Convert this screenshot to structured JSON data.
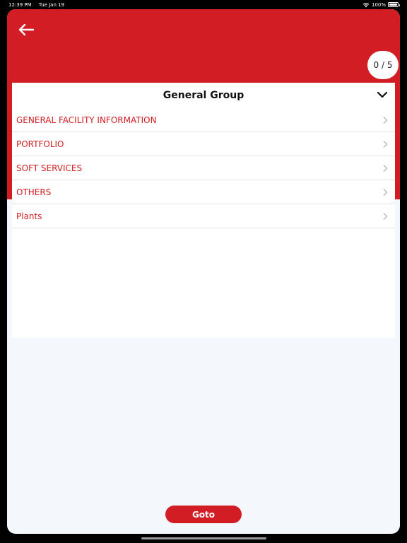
{
  "status_bar": {
    "time": "12:39 PM",
    "date": "Tue Jan 19",
    "battery": "100%",
    "wifi_icon": "wifi-icon",
    "battery_icon": "battery-icon"
  },
  "header": {
    "back_icon": "arrow-left-icon",
    "progress": "0 / 5"
  },
  "group": {
    "title": "General Group",
    "toggle_icon": "chevron-down-icon",
    "items": [
      {
        "label": "GENERAL FACILITY INFORMATION"
      },
      {
        "label": "PORTFOLIO"
      },
      {
        "label": "SOFT SERVICES"
      },
      {
        "label": "OTHERS"
      },
      {
        "label": "Plants"
      }
    ]
  },
  "footer": {
    "goto_label": "Goto"
  },
  "colors": {
    "brand_red": "#d21d24",
    "background": "#f4f7fc"
  }
}
